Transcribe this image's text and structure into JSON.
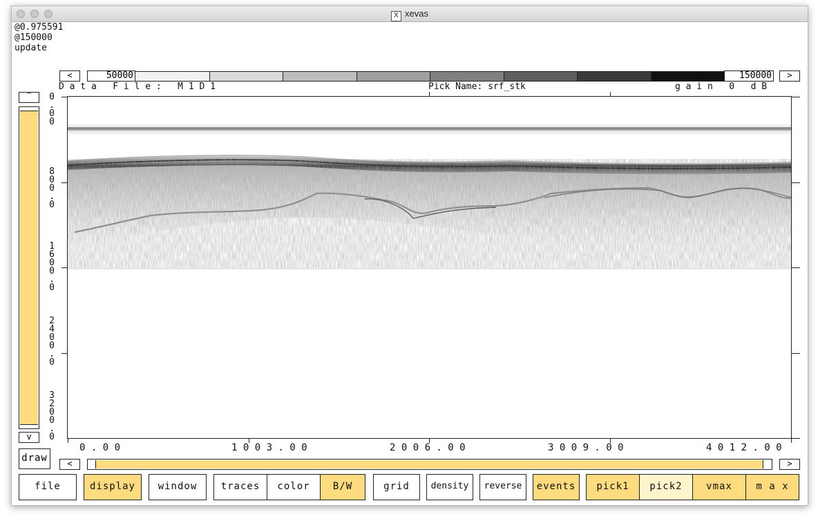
{
  "window": {
    "title": "xevas",
    "title_icon": "X"
  },
  "status": [
    "@0.975591",
    "@150000",
    "update"
  ],
  "colorbar": {
    "min_label": "50000",
    "max_label": "150000",
    "left_arrow": "<",
    "right_arrow": ">"
  },
  "info": {
    "data_file": "D a t a   F i l e :   M 1 D 1",
    "pick_name": "Pick Name: srf_stk",
    "gain": "g a i n   0   d B"
  },
  "y_axis": {
    "labels": [
      [
        "0",
        ".",
        "0",
        "0"
      ],
      [
        "8",
        "0",
        "0",
        ".",
        "0"
      ],
      [
        "1",
        "6",
        "0",
        "0",
        ".",
        "0"
      ],
      [
        "2",
        "4",
        "0",
        "0",
        ".",
        "0"
      ],
      [
        "3",
        "2",
        "0",
        "0",
        ".",
        "0"
      ]
    ]
  },
  "x_axis": {
    "labels": [
      "0 . 0 0",
      "1 0 0 3 . 0 0",
      "2 0 0 6 . 0 0",
      "3 0 0 9 . 0 0",
      "4 0 1 2 . 0 0"
    ]
  },
  "vscroll": {
    "up_label": "^",
    "down_label": "v"
  },
  "hscroll": {
    "left_arrow": "<",
    "right_arrow": ">"
  },
  "draw_label": "draw",
  "buttons": {
    "file": "file",
    "display": "display",
    "window": "window",
    "traces": "traces",
    "color": "color",
    "bw": "B/W",
    "grid": "grid",
    "density": "density",
    "reverse": "reverse",
    "events": "events",
    "pick1": "pick1",
    "pick2": "pick2",
    "vmax": "vmax",
    "max": "m a x"
  },
  "colors": {
    "accent": "#fedb7e",
    "accent_light": "#fff4cc",
    "ink": "#222222"
  }
}
